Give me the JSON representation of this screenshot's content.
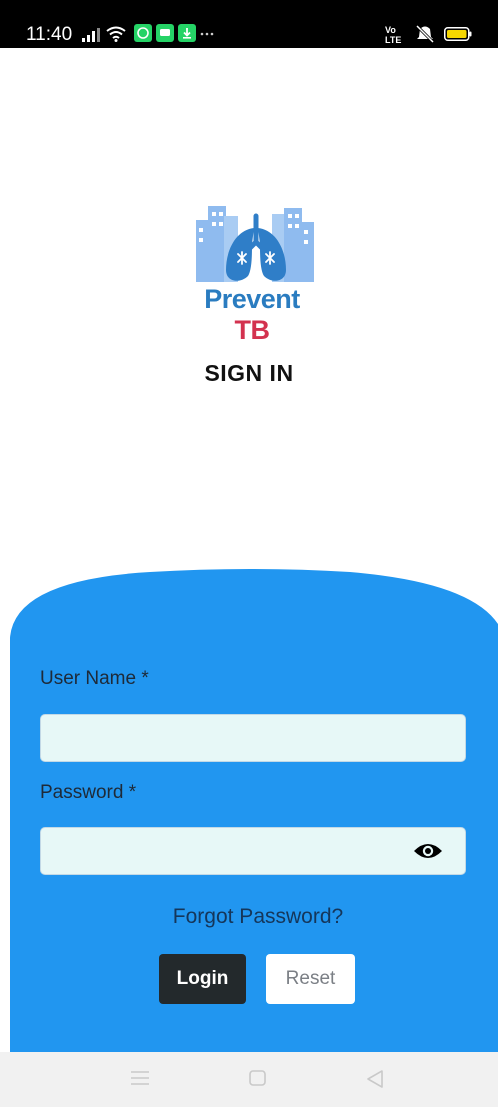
{
  "status_bar": {
    "time": "11:40",
    "icons_left": [
      "signal-icon",
      "wifi-icon",
      "whatsapp-icon",
      "message-icon",
      "download-icon",
      "more-dots-icon"
    ],
    "icons_right": [
      "volte-icon",
      "mute-icon",
      "battery-icon"
    ]
  },
  "logo": {
    "word1": "Prevent",
    "word2": "TB",
    "colors": {
      "blue": "#2a7cc0",
      "red": "#d3324f",
      "light_blue": "#8fbbef"
    }
  },
  "heading": "SIGN IN",
  "form": {
    "username_label": "User Name *",
    "username_value": "",
    "password_label": "Password *",
    "password_value": "",
    "forgot_password": "Forgot Password?",
    "login_label": "Login",
    "reset_label": "Reset"
  },
  "colors": {
    "panel": "#2196f0",
    "field_bg": "#e7f8f7",
    "login_bg": "#23292c"
  },
  "nav_bar": {
    "icons": [
      "menu-icon",
      "home-square-icon",
      "back-triangle-icon"
    ]
  }
}
